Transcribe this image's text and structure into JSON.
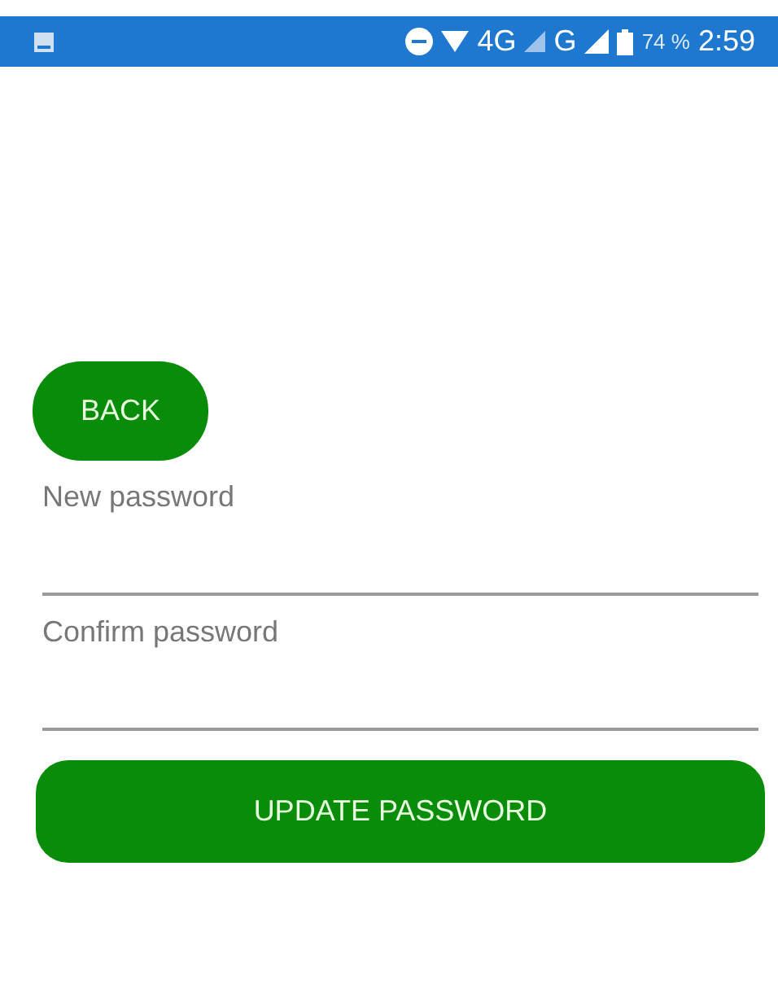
{
  "status_bar": {
    "network": "4G",
    "network_2": "G",
    "battery": "74 %",
    "time": "2:59"
  },
  "back_button": "BACK",
  "fields": [
    {
      "placeholder": "New password"
    },
    {
      "placeholder": "Confirm password"
    }
  ],
  "submit_button": "UPDATE PASSWORD"
}
